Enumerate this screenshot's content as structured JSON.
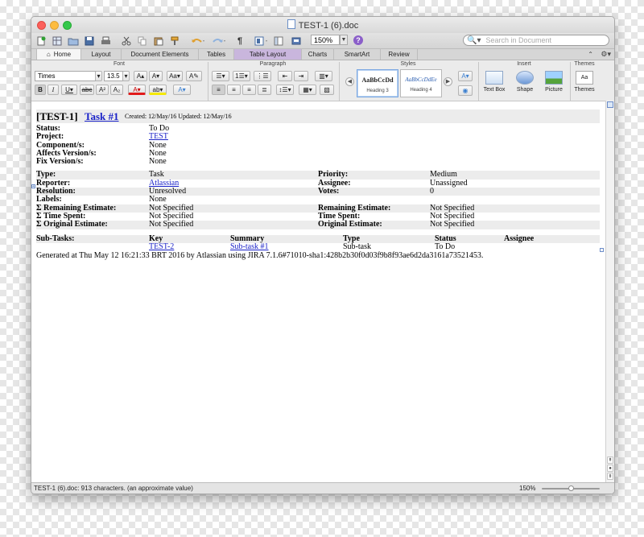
{
  "window": {
    "title": "TEST-1 (6).doc"
  },
  "toolbar": {
    "zoom": "150%",
    "search_placeholder": "Search in Document",
    "help": "?"
  },
  "tabs": [
    "Home",
    "Layout",
    "Document Elements",
    "Tables",
    "Table Layout",
    "Charts",
    "SmartArt",
    "Review"
  ],
  "ribbon": {
    "groups": {
      "font": "Font",
      "paragraph": "Paragraph",
      "styles": "Styles",
      "insert": "Insert",
      "themes": "Themes"
    },
    "font_name": "Times",
    "font_size": "13.5",
    "style_heading3_sample": "AaBbCcDd",
    "style_heading3": "Heading 3",
    "style_heading4_sample": "AaBbCcDdEe",
    "style_heading4": "Heading 4",
    "insert_textbox": "Text Box",
    "insert_shape": "Shape",
    "insert_picture": "Picture",
    "themes_label": "Themes",
    "themes_sample": "Aa"
  },
  "issue": {
    "key_label": "[TEST-1]",
    "summary": "Task #1",
    "meta": "Created: 12/May/16  Updated: 12/May/16",
    "fields": [
      {
        "label": "Status:",
        "value": "To Do"
      },
      {
        "label": "Project:",
        "value": "TEST",
        "link": true
      },
      {
        "label": "Component/s:",
        "value": "None"
      },
      {
        "label": "Affects Version/s:",
        "value": "None"
      },
      {
        "label": "Fix Version/s:",
        "value": "None"
      }
    ],
    "details": [
      {
        "label": "Type:",
        "value": "Task",
        "label2": "Priority:",
        "value2": "Medium"
      },
      {
        "label": "Reporter:",
        "value": "Atlassian",
        "link": true,
        "label2": "Assignee:",
        "value2": "Unassigned"
      },
      {
        "label": "Resolution:",
        "value": "Unresolved",
        "label2": "Votes:",
        "value2": "0"
      },
      {
        "label": "Labels:",
        "value": "None",
        "label2": "",
        "value2": ""
      },
      {
        "label": "Σ Remaining Estimate:",
        "value": "Not Specified",
        "label2": "Remaining Estimate:",
        "value2": "Not Specified"
      },
      {
        "label": "Σ Time Spent:",
        "value": "Not Specified",
        "label2": "Time Spent:",
        "value2": "Not Specified"
      },
      {
        "label": "Σ Original Estimate:",
        "value": "Not Specified",
        "label2": "Original Estimate:",
        "value2": "Not Specified"
      }
    ],
    "subtasks_header": [
      "Sub-Tasks:",
      "Key",
      "Summary",
      "Type",
      "Status",
      "Assignee"
    ],
    "subtasks": [
      {
        "key": "TEST-2",
        "summary": "Sub-task #1",
        "type": "Sub-task",
        "status": "To Do",
        "assignee": ""
      }
    ],
    "generated": "Generated at Thu May 12 16:21:33 BRT 2016 by Atlassian using JIRA 7.1.6#71010-sha1:428b2b30f0d03f9b8f93ae6d2da3161a73521453."
  },
  "status_bar": {
    "info": "TEST-1 (6).doc: 913 characters. (an approximate value)",
    "zoom": "150%",
    "zoom_slider_level": 0.5
  }
}
